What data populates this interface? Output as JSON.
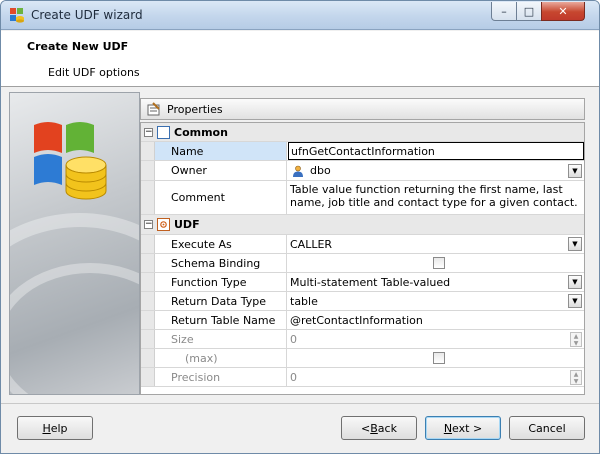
{
  "window": {
    "title": "Create UDF wizard",
    "min_glyph": "–",
    "max_glyph": "□",
    "close_glyph": "✕"
  },
  "header": {
    "title": "Create New UDF",
    "subtitle": "Edit UDF options"
  },
  "properties": {
    "title": "Properties",
    "categories": [
      {
        "toggle": "−",
        "label": "Common",
        "rows": [
          {
            "label": "Name",
            "value": "ufnGetContactInformation"
          },
          {
            "label": "Owner",
            "value": "dbo"
          },
          {
            "label": "Comment",
            "value": "Table value function returning the first name, last name, job title and contact type for a given contact."
          }
        ]
      },
      {
        "toggle": "−",
        "label": "UDF",
        "rows": [
          {
            "label": "Execute As",
            "value": "CALLER"
          },
          {
            "label": "Schema Binding",
            "value": "",
            "checked": false
          },
          {
            "label": "Function Type",
            "value": "Multi-statement Table-valued"
          },
          {
            "label": "Return Data Type",
            "value": "table"
          },
          {
            "label": "Return Table Name",
            "value": "@retContactInformation"
          },
          {
            "label": "Size",
            "value": "0",
            "disabled": true
          },
          {
            "label": "(max)",
            "value": "",
            "checked": false,
            "disabled": true
          },
          {
            "label": "Precision",
            "value": "0",
            "disabled": true
          }
        ]
      }
    ]
  },
  "buttons": {
    "help": {
      "pre": "",
      "key": "H",
      "post": "elp"
    },
    "back": {
      "pre": "< ",
      "key": "B",
      "post": "ack"
    },
    "next": {
      "pre": "",
      "key": "N",
      "post": "ext >"
    },
    "cancel": {
      "label": "Cancel"
    }
  },
  "colors": {
    "selection": "#d0e4f8",
    "accent": "#3c7fb1",
    "close_button": "#c7472f"
  }
}
